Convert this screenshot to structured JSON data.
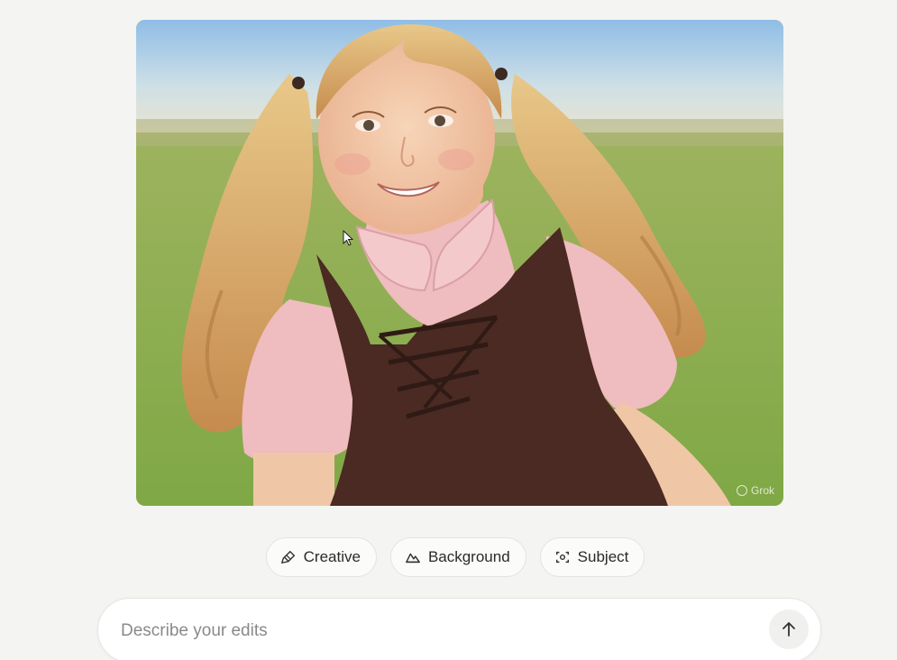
{
  "image": {
    "watermark": "Grok",
    "palette": {
      "sky": "#9ec3e6",
      "grass": "#8cae52",
      "hair": "#d9a865",
      "skin": "#f3c9a8",
      "blouse": "#efbcbf",
      "dress": "#4a2a22"
    }
  },
  "chips": [
    {
      "label": "Creative",
      "icon": "brush-icon"
    },
    {
      "label": "Background",
      "icon": "mountain-icon"
    },
    {
      "label": "Subject",
      "icon": "focus-icon"
    }
  ],
  "prompt": {
    "placeholder": "Describe your edits",
    "value": "",
    "send_icon": "arrow-up-icon"
  }
}
